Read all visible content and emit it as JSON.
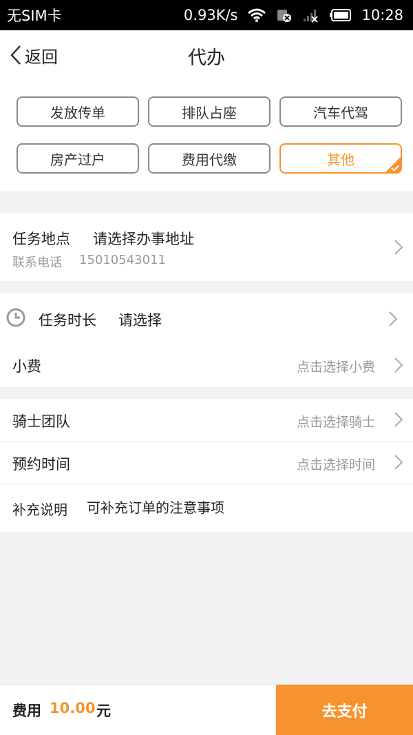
{
  "status_bar": {
    "carrier": "无SIM卡",
    "speed": "0.93K/s",
    "time": "10:28"
  },
  "nav": {
    "back_label": "返回",
    "title": "代办"
  },
  "categories": [
    {
      "label": "发放传单",
      "selected": false
    },
    {
      "label": "排队占座",
      "selected": false
    },
    {
      "label": "汽车代驾",
      "selected": false
    },
    {
      "label": "房产过户",
      "selected": false
    },
    {
      "label": "费用代缴",
      "selected": false
    },
    {
      "label": "其他",
      "selected": true
    }
  ],
  "location": {
    "label": "任务地点",
    "value": "请选择办事地址",
    "phone_label": "联系电话",
    "phone": "15010543011"
  },
  "duration": {
    "label": "任务时长",
    "value": "请选择"
  },
  "tip": {
    "label": "小费",
    "placeholder": "点击选择小费"
  },
  "rider_team": {
    "label": "骑士团队",
    "placeholder": "点击选择骑士"
  },
  "appointment": {
    "label": "预约时间",
    "placeholder": "点击选择时间"
  },
  "notes": {
    "label": "补充说明",
    "placeholder": "可补充订单的注意事项"
  },
  "bottom": {
    "fee_label": "费用",
    "fee_amount": "10.00",
    "fee_unit": "元",
    "pay_label": "去支付"
  },
  "colors": {
    "accent": "#f7932f"
  }
}
